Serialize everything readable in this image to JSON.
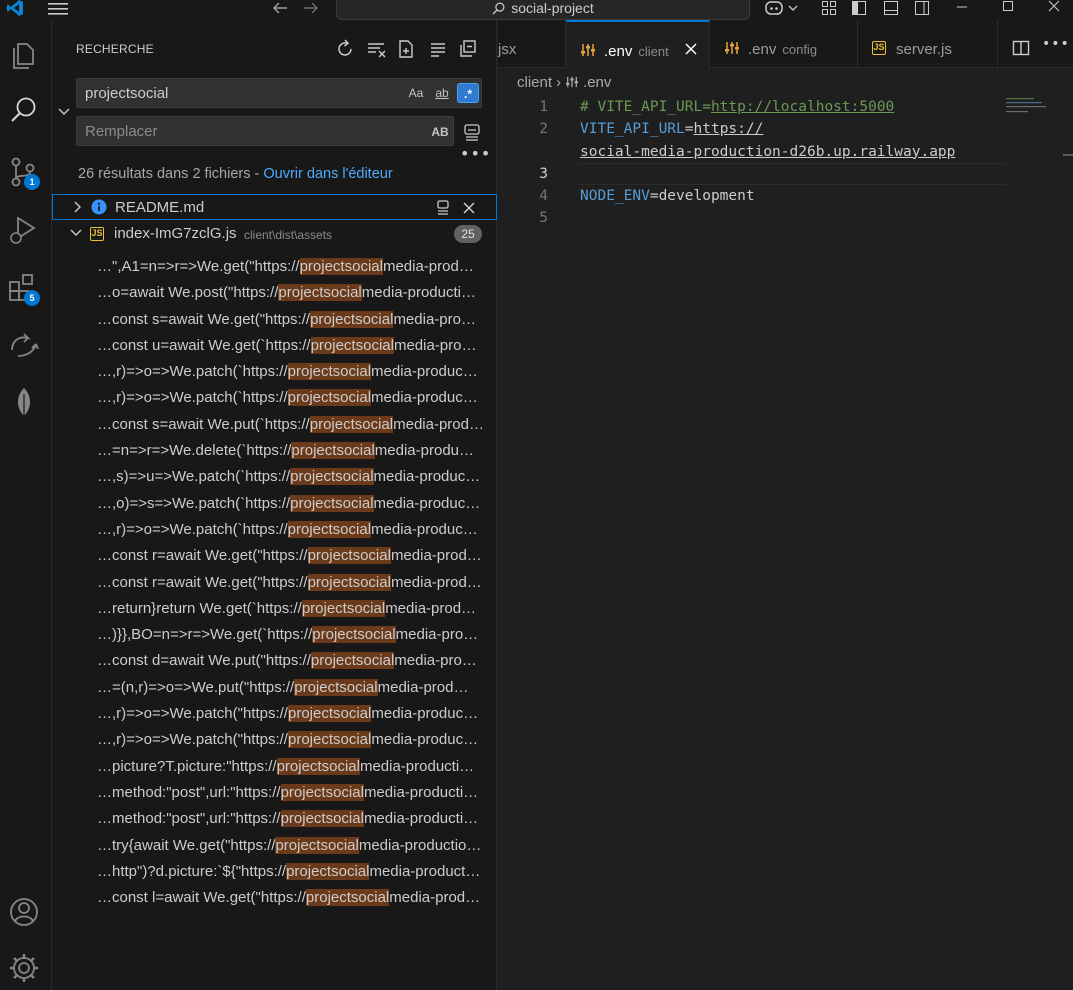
{
  "titlebar": {
    "search_text": "social-project",
    "icons": [
      "vscode-logo-icon",
      "menu-icon",
      "back-arrow-icon",
      "forward-arrow-icon",
      "copilot-icon",
      "customize-layout-icon",
      "toggle-primary-sidebar-icon",
      "toggle-panel-icon",
      "toggle-secondary-sidebar-icon",
      "minimize-icon",
      "maximize-icon",
      "close-icon"
    ]
  },
  "activity_bar": {
    "items": [
      {
        "name": "explorer",
        "icon": "files-icon"
      },
      {
        "name": "search",
        "icon": "search-icon"
      },
      {
        "name": "source-control",
        "icon": "source-control-icon",
        "badge": "1"
      },
      {
        "name": "run-debug",
        "icon": "run-debug-icon"
      },
      {
        "name": "extensions",
        "icon": "extensions-icon",
        "badge": "5"
      },
      {
        "name": "remote",
        "icon": "remote-icon"
      },
      {
        "name": "mongodb",
        "icon": "leaf-icon"
      }
    ],
    "bottom": [
      {
        "name": "accounts",
        "icon": "account-icon"
      },
      {
        "name": "manage",
        "icon": "gear-icon"
      }
    ]
  },
  "sidebar": {
    "title": "RECHERCHE",
    "search": {
      "value": "projectsocial",
      "options": {
        "match_case": "Aa",
        "whole_word": "ab",
        "regex": ".*"
      }
    },
    "replace": {
      "placeholder": "Remplacer",
      "replace_all": "AB"
    },
    "summary": {
      "text": "26 résultats dans 2 fichiers - ",
      "link": "Ouvrir dans l'éditeur"
    },
    "files": [
      {
        "name": "README.md",
        "path": "",
        "icon": "info-icon",
        "expanded": false
      },
      {
        "name": "index-ImG7zclG.js",
        "path": "client\\dist\\assets",
        "icon": "js-file-icon",
        "expanded": true,
        "count": "25"
      }
    ],
    "match": "projectsocial",
    "results": [
      {
        "pre": "…\",A1=n=>r=>We.get(\"https://",
        "post": "media-prod…"
      },
      {
        "pre": "…o=await We.post(\"https://",
        "post": "media-producti…"
      },
      {
        "pre": "…const s=await We.get(\"https://",
        "post": "media-pro…"
      },
      {
        "pre": "…const u=await We.get(`https://",
        "post": "media-pro…"
      },
      {
        "pre": "…,r)=>o=>We.patch(`https://",
        "post": "media-produc…"
      },
      {
        "pre": "…,r)=>o=>We.patch(`https://",
        "post": "media-produc…"
      },
      {
        "pre": "…const s=await We.put(`https://",
        "post": "media-prod…"
      },
      {
        "pre": "…=n=>r=>We.delete(`https://",
        "post": "media-produ…"
      },
      {
        "pre": "…,s)=>u=>We.patch(`https://",
        "post": "media-produc…"
      },
      {
        "pre": "…,o)=>s=>We.patch(`https://",
        "post": "media-produc…"
      },
      {
        "pre": "…,r)=>o=>We.patch(`https://",
        "post": "media-produc…"
      },
      {
        "pre": "…const r=await We.get(\"https://",
        "post": "media-prod…"
      },
      {
        "pre": "…const r=await We.get(\"https://",
        "post": "media-prod…"
      },
      {
        "pre": "…return}return We.get(`https://",
        "post": "media-prod…"
      },
      {
        "pre": "…)}},BO=n=>r=>We.get(`https://",
        "post": "media-pro…"
      },
      {
        "pre": "…const d=await We.put(\"https://",
        "post": "media-pro…"
      },
      {
        "pre": "…=(n,r)=>o=>We.put(\"https://",
        "post": "media-prod…"
      },
      {
        "pre": "…,r)=>o=>We.patch(\"https://",
        "post": "media-produc…"
      },
      {
        "pre": "…,r)=>o=>We.patch(\"https://",
        "post": "media-produc…"
      },
      {
        "pre": "…picture?T.picture:\"https://",
        "post": "media-producti…"
      },
      {
        "pre": "…method:\"post\",url:\"https://",
        "post": "media-producti…"
      },
      {
        "pre": "…method:\"post\",url:\"https://",
        "post": "media-producti…"
      },
      {
        "pre": "…try{await We.get(\"https://",
        "post": "media-productio…"
      },
      {
        "pre": "…http\")?d.picture:`${\"https://",
        "post": "media-product…"
      },
      {
        "pre": "…const l=await We.get(\"https://",
        "post": "media-prod…"
      }
    ]
  },
  "editor": {
    "tabs": [
      {
        "label": "jsx",
        "desc": "",
        "icon": ""
      },
      {
        "label": ".env",
        "desc": "client",
        "icon": "settings-file-icon",
        "active": true
      },
      {
        "label": ".env",
        "desc": "config",
        "icon": "settings-file-icon"
      },
      {
        "label": "server.js",
        "desc": "",
        "icon": "js-file-icon"
      }
    ],
    "breadcrumb": [
      "client",
      ".env"
    ],
    "lines": [
      {
        "n": "1",
        "comment": "# VITE_API_URL=",
        "link": "http://localhost:5000"
      },
      {
        "n": "2",
        "key": "VITE_API_URL",
        "eq": "=",
        "value": "https://"
      },
      {
        "n": "",
        "cont": "social-media-production-d26b.up.railway.app"
      },
      {
        "n": "3",
        "empty": true
      },
      {
        "n": "4",
        "key": "NODE_ENV",
        "eq": "=",
        "value": "development"
      },
      {
        "n": "5",
        "empty": true
      }
    ]
  },
  "colors": {
    "accent": "#0078d4",
    "match_highlight": "#6b3a1a",
    "link": "#4daafc",
    "comment": "#6a9955",
    "keyword": "#569cd6"
  }
}
